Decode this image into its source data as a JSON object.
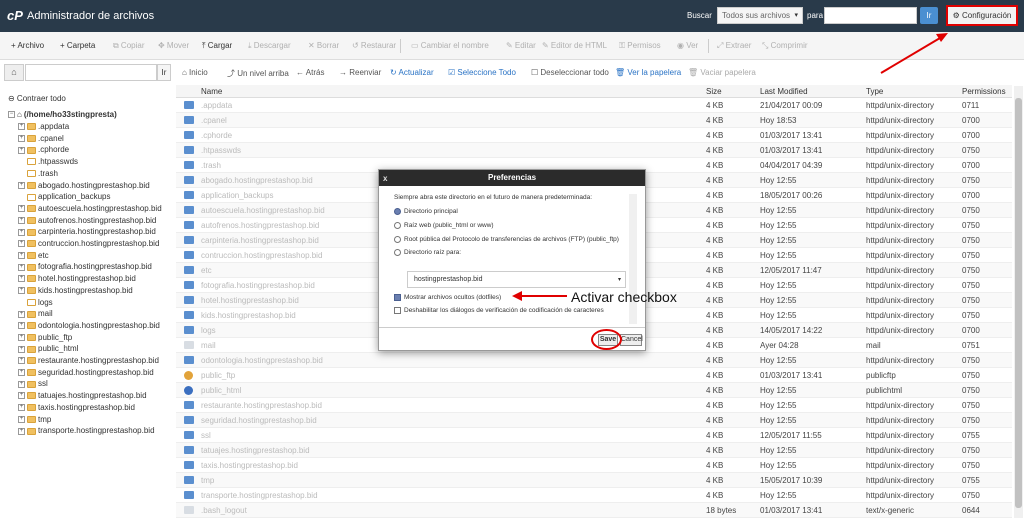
{
  "header": {
    "logo": "cP",
    "title": "Administrador de archivos",
    "search_label": "Buscar",
    "search_scope": "Todos sus archivos",
    "para_label": "para",
    "go_label": "Ir",
    "settings_label": "⚙ Configuración"
  },
  "toolbar": [
    {
      "label": "+ Archivo",
      "enabled": true
    },
    {
      "label": "+ Carpeta",
      "enabled": true
    },
    {
      "label": "⧉ Copiar",
      "enabled": false
    },
    {
      "label": "✥ Mover",
      "enabled": false
    },
    {
      "label": "⤒ Cargar",
      "enabled": true
    },
    {
      "label": "⤓ Descargar",
      "enabled": false
    },
    {
      "label": "✕ Borrar",
      "enabled": false
    },
    {
      "label": "↺ Restaurar",
      "enabled": false
    },
    {
      "label": "▭ Cambiar el nombre",
      "enabled": false
    },
    {
      "label": "✎ Editar",
      "enabled": false
    },
    {
      "label": "✎ Editor de HTML",
      "enabled": false
    },
    {
      "label": "⚿ Permisos",
      "enabled": false
    },
    {
      "label": "◉ Ver",
      "enabled": false
    },
    {
      "label": "⤢ Extraer",
      "enabled": false
    },
    {
      "label": "⤡ Comprimir",
      "enabled": false
    }
  ],
  "pathbar": {
    "go_label": "Ir"
  },
  "nav": [
    {
      "label": "⌂ Inicio",
      "style": "normal"
    },
    {
      "label": "⤴ Un nivel arriba",
      "style": "normal"
    },
    {
      "label": "← Atrás",
      "style": "normal"
    },
    {
      "label": "→ Reenviar",
      "style": "normal"
    },
    {
      "label": "↻ Actualizar",
      "style": "blue"
    },
    {
      "label": "☑ Seleccione Todo",
      "style": "blue"
    },
    {
      "label": "☐ Deseleccionar todo",
      "style": "normal"
    },
    {
      "label": "🗑 Ver la papelera",
      "style": "blue"
    },
    {
      "label": "🗑 Vaciar papelera",
      "style": "disabled"
    }
  ],
  "tree": {
    "collapse_label": "⊖ Contraer todo",
    "root": "(/home/ho33stingpresta)",
    "items": [
      {
        "label": ".appdata",
        "exp": true
      },
      {
        "label": ".cpanel",
        "exp": true
      },
      {
        "label": ".cphorde",
        "exp": true
      },
      {
        "label": ".htpasswds",
        "exp": false
      },
      {
        "label": ".trash",
        "exp": false
      },
      {
        "label": "abogado.hostingprestashop.bid",
        "exp": true
      },
      {
        "label": "application_backups",
        "exp": false
      },
      {
        "label": "autoescuela.hostingprestashop.bid",
        "exp": true
      },
      {
        "label": "autofrenos.hostingprestashop.bid",
        "exp": true
      },
      {
        "label": "carpinteria.hostingprestashop.bid",
        "exp": true
      },
      {
        "label": "contruccion.hostingprestashop.bid",
        "exp": true
      },
      {
        "label": "etc",
        "exp": true
      },
      {
        "label": "fotografia.hostingprestashop.bid",
        "exp": true
      },
      {
        "label": "hotel.hostingprestashop.bid",
        "exp": true
      },
      {
        "label": "kids.hostingprestashop.bid",
        "exp": true
      },
      {
        "label": "logs",
        "exp": false
      },
      {
        "label": "mail",
        "exp": true
      },
      {
        "label": "odontologia.hostingprestashop.bid",
        "exp": true
      },
      {
        "label": "public_ftp",
        "exp": true
      },
      {
        "label": "public_html",
        "exp": true
      },
      {
        "label": "restaurante.hostingprestashop.bid",
        "exp": true
      },
      {
        "label": "seguridad.hostingprestashop.bid",
        "exp": true
      },
      {
        "label": "ssl",
        "exp": true
      },
      {
        "label": "tatuajes.hostingprestashop.bid",
        "exp": true
      },
      {
        "label": "taxis.hostingprestashop.bid",
        "exp": true
      },
      {
        "label": "tmp",
        "exp": true
      },
      {
        "label": "transporte.hostingprestashop.bid",
        "exp": true
      }
    ]
  },
  "table": {
    "columns": [
      "Name",
      "Size",
      "Last Modified",
      "Type",
      "Permissions"
    ],
    "rows": [
      {
        "name": ".appdata",
        "size": "4 KB",
        "modified": "21/04/2017 00:09",
        "type": "httpd/unix-directory",
        "perm": "0711",
        "icon": "folder"
      },
      {
        "name": ".cpanel",
        "size": "4 KB",
        "modified": "Hoy 18:53",
        "type": "httpd/unix-directory",
        "perm": "0700",
        "icon": "folder"
      },
      {
        "name": ".cphorde",
        "size": "4 KB",
        "modified": "01/03/2017 13:41",
        "type": "httpd/unix-directory",
        "perm": "0700",
        "icon": "folder"
      },
      {
        "name": ".htpasswds",
        "size": "4 KB",
        "modified": "01/03/2017 13:41",
        "type": "httpd/unix-directory",
        "perm": "0750",
        "icon": "folder"
      },
      {
        "name": ".trash",
        "size": "4 KB",
        "modified": "04/04/2017 04:39",
        "type": "httpd/unix-directory",
        "perm": "0700",
        "icon": "folder"
      },
      {
        "name": "abogado.hostingprestashop.bid",
        "size": "4 KB",
        "modified": "Hoy 12:55",
        "type": "httpd/unix-directory",
        "perm": "0750",
        "icon": "folder"
      },
      {
        "name": "application_backups",
        "size": "4 KB",
        "modified": "18/05/2017 00:26",
        "type": "httpd/unix-directory",
        "perm": "0700",
        "icon": "folder"
      },
      {
        "name": "autoescuela.hostingprestashop.bid",
        "size": "4 KB",
        "modified": "Hoy 12:55",
        "type": "httpd/unix-directory",
        "perm": "0750",
        "icon": "folder"
      },
      {
        "name": "autofrenos.hostingprestashop.bid",
        "size": "4 KB",
        "modified": "Hoy 12:55",
        "type": "httpd/unix-directory",
        "perm": "0750",
        "icon": "folder"
      },
      {
        "name": "carpinteria.hostingprestashop.bid",
        "size": "4 KB",
        "modified": "Hoy 12:55",
        "type": "httpd/unix-directory",
        "perm": "0750",
        "icon": "folder"
      },
      {
        "name": "contruccion.hostingprestashop.bid",
        "size": "4 KB",
        "modified": "Hoy 12:55",
        "type": "httpd/unix-directory",
        "perm": "0750",
        "icon": "folder"
      },
      {
        "name": "etc",
        "size": "4 KB",
        "modified": "12/05/2017 11:47",
        "type": "httpd/unix-directory",
        "perm": "0750",
        "icon": "folder"
      },
      {
        "name": "fotografia.hostingprestashop.bid",
        "size": "4 KB",
        "modified": "Hoy 12:55",
        "type": "httpd/unix-directory",
        "perm": "0750",
        "icon": "folder"
      },
      {
        "name": "hotel.hostingprestashop.bid",
        "size": "4 KB",
        "modified": "Hoy 12:55",
        "type": "httpd/unix-directory",
        "perm": "0750",
        "icon": "folder"
      },
      {
        "name": "kids.hostingprestashop.bid",
        "size": "4 KB",
        "modified": "Hoy 12:55",
        "type": "httpd/unix-directory",
        "perm": "0750",
        "icon": "folder"
      },
      {
        "name": "logs",
        "size": "4 KB",
        "modified": "14/05/2017 14:22",
        "type": "httpd/unix-directory",
        "perm": "0700",
        "icon": "folder"
      },
      {
        "name": "mail",
        "size": "4 KB",
        "modified": "Ayer 04:28",
        "type": "mail",
        "perm": "0751",
        "icon": "file"
      },
      {
        "name": "odontologia.hostingprestashop.bid",
        "size": "4 KB",
        "modified": "Hoy 12:55",
        "type": "httpd/unix-directory",
        "perm": "0750",
        "icon": "folder"
      },
      {
        "name": "public_ftp",
        "size": "4 KB",
        "modified": "01/03/2017 13:41",
        "type": "publicftp",
        "perm": "0750",
        "icon": "special"
      },
      {
        "name": "public_html",
        "size": "4 KB",
        "modified": "Hoy 12:55",
        "type": "publichtml",
        "perm": "0750",
        "icon": "globe"
      },
      {
        "name": "restaurante.hostingprestashop.bid",
        "size": "4 KB",
        "modified": "Hoy 12:55",
        "type": "httpd/unix-directory",
        "perm": "0750",
        "icon": "folder"
      },
      {
        "name": "seguridad.hostingprestashop.bid",
        "size": "4 KB",
        "modified": "Hoy 12:55",
        "type": "httpd/unix-directory",
        "perm": "0750",
        "icon": "folder"
      },
      {
        "name": "ssl",
        "size": "4 KB",
        "modified": "12/05/2017 11:55",
        "type": "httpd/unix-directory",
        "perm": "0755",
        "icon": "folder"
      },
      {
        "name": "tatuajes.hostingprestashop.bid",
        "size": "4 KB",
        "modified": "Hoy 12:55",
        "type": "httpd/unix-directory",
        "perm": "0750",
        "icon": "folder"
      },
      {
        "name": "taxis.hostingprestashop.bid",
        "size": "4 KB",
        "modified": "Hoy 12:55",
        "type": "httpd/unix-directory",
        "perm": "0750",
        "icon": "folder"
      },
      {
        "name": "tmp",
        "size": "4 KB",
        "modified": "15/05/2017 10:39",
        "type": "httpd/unix-directory",
        "perm": "0755",
        "icon": "folder"
      },
      {
        "name": "transporte.hostingprestashop.bid",
        "size": "4 KB",
        "modified": "Hoy 12:55",
        "type": "httpd/unix-directory",
        "perm": "0750",
        "icon": "folder"
      },
      {
        "name": ".bash_logout",
        "size": "18 bytes",
        "modified": "01/03/2017 13:41",
        "type": "text/x-generic",
        "perm": "0644",
        "icon": "file"
      }
    ]
  },
  "modal": {
    "title": "Preferencias",
    "close_label": "x",
    "intro": "Siempre abra este directorio en el futuro de manera predeterminada:",
    "options": [
      {
        "label": "Directorio principal",
        "selected": true
      },
      {
        "label": "Raíz web (public_html or www)",
        "selected": false
      },
      {
        "label": "Root pública del Protocolo de transferencias de archivos (FTP) (public_ftp)",
        "selected": false
      },
      {
        "label": "Directorio raíz para:",
        "selected": false
      }
    ],
    "domain_select": "hostingprestashop.bid",
    "checkboxes": [
      {
        "label": "Mostrar archivos ocultos (dotfiles)",
        "checked": true
      },
      {
        "label": "Deshabilitar los diálogos de verificación de codificación de caracteres",
        "checked": false
      }
    ],
    "save_label": "Save",
    "cancel_label": "Cancel"
  },
  "annotation": {
    "text": "Activar checkbox",
    "color": "#e00000"
  }
}
